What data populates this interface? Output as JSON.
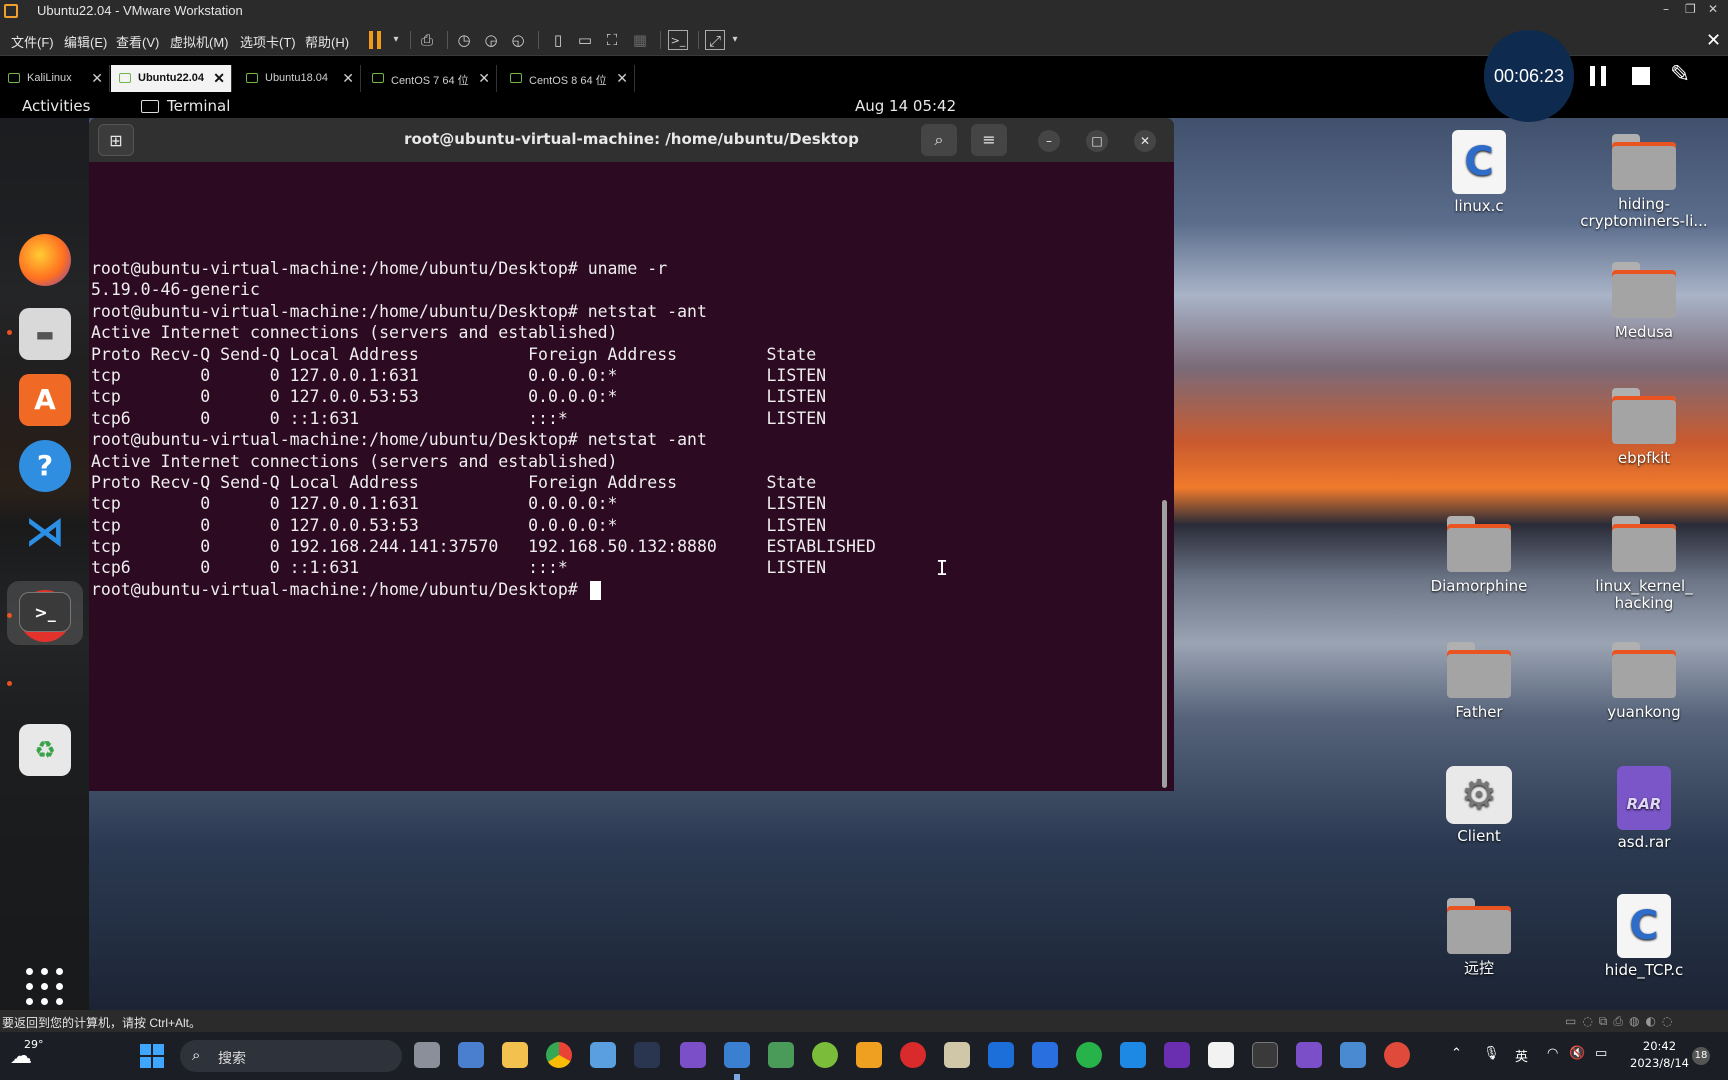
{
  "vmware": {
    "window_title": "Ubuntu22.04 - VMware Workstation",
    "menus": [
      "文件(F)",
      "编辑(E)",
      "查看(V)",
      "虚拟机(M)",
      "选项卡(T)",
      "帮助(H)"
    ],
    "tabs": [
      {
        "label": "KaliLinux",
        "active": false
      },
      {
        "label": "Ubuntu22.04",
        "active": true
      },
      {
        "label": "Ubuntu18.04",
        "active": false
      },
      {
        "label": "CentOS 7 64 位",
        "active": false
      },
      {
        "label": "CentOS 8 64 位",
        "active": false
      }
    ],
    "status_message": "要返回到您的计算机，请按 Ctrl+Alt。",
    "accent_color": "#f29a1a"
  },
  "recorder": {
    "elapsed": "00:06:23"
  },
  "ubuntu": {
    "topbar": {
      "activities": "Activities",
      "app_name": "Terminal",
      "clock": "Aug 14  05:42"
    },
    "dock": [
      "firefox-icon",
      "files-icon",
      "app-center-icon",
      "help-icon",
      "vscode-icon",
      "alert-icon",
      "terminal-icon",
      "trash-icon"
    ],
    "terminal": {
      "title": "root@ubuntu-virtual-machine: /home/ubuntu/Desktop",
      "lines": [
        "root@ubuntu-virtual-machine:/home/ubuntu/Desktop# uname -r",
        "5.19.0-46-generic",
        "root@ubuntu-virtual-machine:/home/ubuntu/Desktop# netstat -ant",
        "Active Internet connections (servers and established)",
        "Proto Recv-Q Send-Q Local Address           Foreign Address         State",
        "tcp        0      0 127.0.0.1:631           0.0.0.0:*               LISTEN",
        "tcp        0      0 127.0.0.53:53           0.0.0.0:*               LISTEN",
        "tcp6       0      0 ::1:631                 :::*                    LISTEN",
        "root@ubuntu-virtual-machine:/home/ubuntu/Desktop# netstat -ant",
        "Active Internet connections (servers and established)",
        "Proto Recv-Q Send-Q Local Address           Foreign Address         State",
        "tcp        0      0 127.0.0.1:631           0.0.0.0:*               LISTEN",
        "tcp        0      0 127.0.0.53:53           0.0.0.0:*               LISTEN",
        "tcp        0      0 192.168.244.141:37570   192.168.50.132:8880     ESTABLISHED",
        "tcp6       0      0 ::1:631                 :::*                    LISTEN"
      ],
      "prompt": "root@ubuntu-virtual-machine:/home/ubuntu/Desktop# ",
      "background_color": "#2c0a22"
    },
    "desktop_icons": [
      {
        "label": "linux.c",
        "kind": "c-file-icon"
      },
      {
        "label": "hiding-cryptominers-li...",
        "kind": "folder-icon"
      },
      {
        "label": "Medusa",
        "kind": "folder-icon"
      },
      {
        "label": "ebpfkit",
        "kind": "folder-icon"
      },
      {
        "label": "Diamorphine",
        "kind": "folder-icon"
      },
      {
        "label": "linux_kernel_ hacking",
        "kind": "folder-icon"
      },
      {
        "label": "Father",
        "kind": "folder-icon"
      },
      {
        "label": "yuankong",
        "kind": "folder-icon"
      },
      {
        "label": "Client",
        "kind": "gear-icon"
      },
      {
        "label": "asd.rar",
        "kind": "rar-archive-icon"
      },
      {
        "label": "远控",
        "kind": "folder-icon"
      },
      {
        "label": "hide_TCP.c",
        "kind": "c-file-icon"
      }
    ]
  },
  "windows": {
    "weather_temp": "29°",
    "search_placeholder": "搜索",
    "tray": {
      "ime": "英",
      "time": "20:42",
      "date": "2023/8/14",
      "notifications": "18"
    }
  }
}
